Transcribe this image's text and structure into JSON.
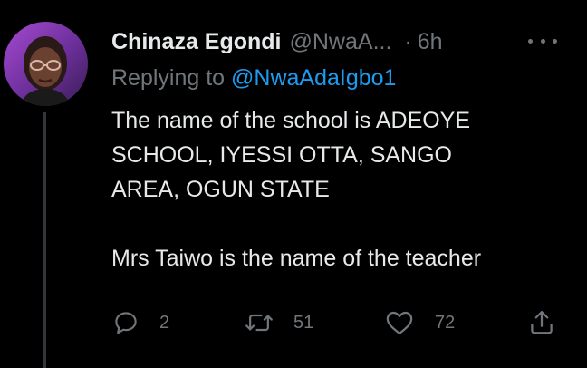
{
  "tweet": {
    "author_name": "Chinaza Egondi",
    "author_handle": "@NwaA...",
    "separator": "·",
    "time": "6h",
    "replying_prefix": "Replying to",
    "replying_to": "@NwaAdaIgbo1",
    "text_line_1": "The name of the school is ADEOYE",
    "text_line_2": "SCHOOL, IYESSI OTTA, SANGO",
    "text_line_3": "AREA, OGUN STATE",
    "text_line_4": "Mrs Taiwo is the name of the teacher"
  },
  "actions": {
    "reply_icon": "reply-icon",
    "reply_count": "2",
    "retweet_icon": "retweet-icon",
    "retweet_count": "51",
    "like_icon": "heart-icon",
    "like_count": "72",
    "share_icon": "share-icon"
  },
  "colors": {
    "background": "#000000",
    "primary_text": "#e7e9ea",
    "secondary_text": "#71767b",
    "link": "#1d9bf0",
    "thread_line": "#333639"
  }
}
